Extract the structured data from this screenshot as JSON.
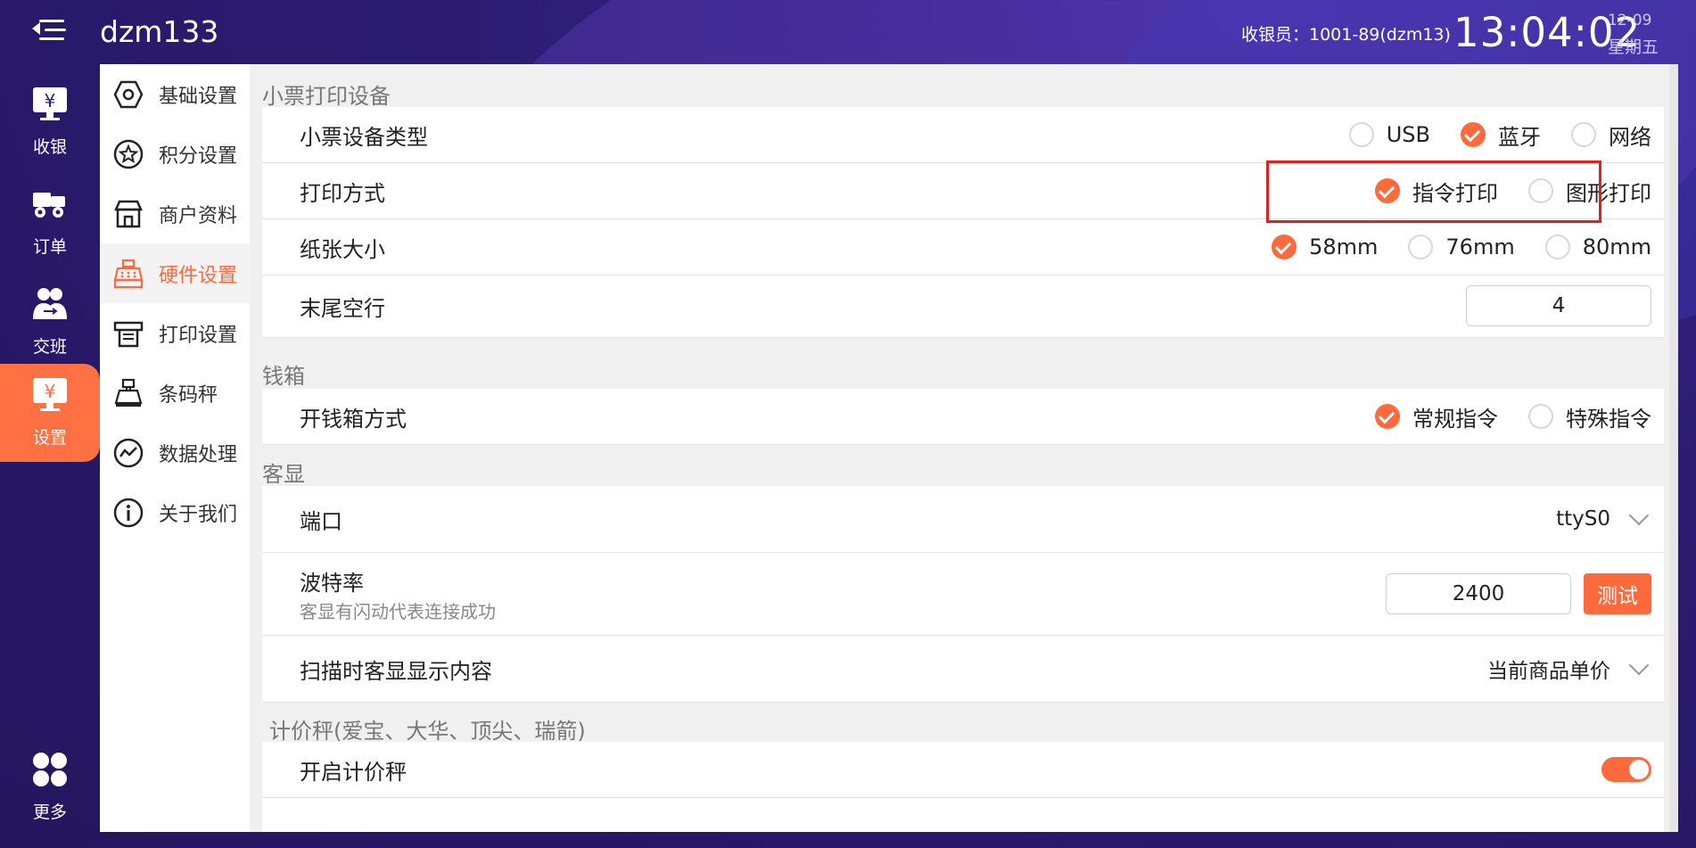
{
  "header": {
    "store_name": "dzm133",
    "cashier": "收银员：1001-89(dzm13)",
    "time": "13:04:02",
    "date": "12-09",
    "weekday": "星期五"
  },
  "rail": {
    "items": [
      {
        "label": "收银",
        "icon": "cashier-monitor-icon"
      },
      {
        "label": "订单",
        "icon": "order-truck-icon"
      },
      {
        "label": "交班",
        "icon": "shift-handover-icon"
      },
      {
        "label": "设置",
        "icon": "settings-monitor-icon",
        "active": true
      }
    ],
    "more": {
      "label": "更多",
      "icon": "grid-four-icon"
    }
  },
  "subnav": {
    "items": [
      {
        "label": "基础设置",
        "icon": "hexagon-nut-icon"
      },
      {
        "label": "积分设置",
        "icon": "star-badge-icon"
      },
      {
        "label": "商户资料",
        "icon": "store-icon"
      },
      {
        "label": "硬件设置",
        "icon": "cash-register-icon",
        "active": true
      },
      {
        "label": "打印设置",
        "icon": "printer-icon"
      },
      {
        "label": "条码秤",
        "icon": "scale-icon"
      },
      {
        "label": "数据处理",
        "icon": "chart-circle-icon"
      },
      {
        "label": "关于我们",
        "icon": "info-icon"
      }
    ]
  },
  "receipt_printer": {
    "section_title": "小票打印设备",
    "device_type": {
      "label": "小票设备类型",
      "options": [
        "USB",
        "蓝牙",
        "网络"
      ],
      "selected": "蓝牙"
    },
    "print_mode": {
      "label": "打印方式",
      "options": [
        "指令打印",
        "图形打印"
      ],
      "selected": "指令打印"
    },
    "paper_size": {
      "label": "纸张大小",
      "options": [
        "58mm",
        "76mm",
        "80mm"
      ],
      "selected": "58mm"
    },
    "tail_blank_lines": {
      "label": "末尾空行",
      "value": "4"
    }
  },
  "cash_drawer": {
    "section_title": "钱箱",
    "open_mode": {
      "label": "开钱箱方式",
      "options": [
        "常规指令",
        "特殊指令"
      ],
      "selected": "常规指令"
    }
  },
  "customer_display": {
    "section_title": "客显",
    "port": {
      "label": "端口",
      "value": "ttyS0"
    },
    "baud_rate": {
      "label": "波特率",
      "hint": "客显有闪动代表连接成功",
      "value": "2400",
      "test_button": "测试"
    },
    "scan_display": {
      "label": "扫描时客显显示内容",
      "value": "当前商品单价"
    }
  },
  "pricing_scale": {
    "section_title": "计价秤(爱宝、大华、顶尖、瑞箭)",
    "enable": {
      "label": "开启计价秤",
      "on": true
    }
  },
  "colors": {
    "accent": "#ff6a3d",
    "highlight_box": "#e0201e",
    "background": "#2b1c72"
  }
}
